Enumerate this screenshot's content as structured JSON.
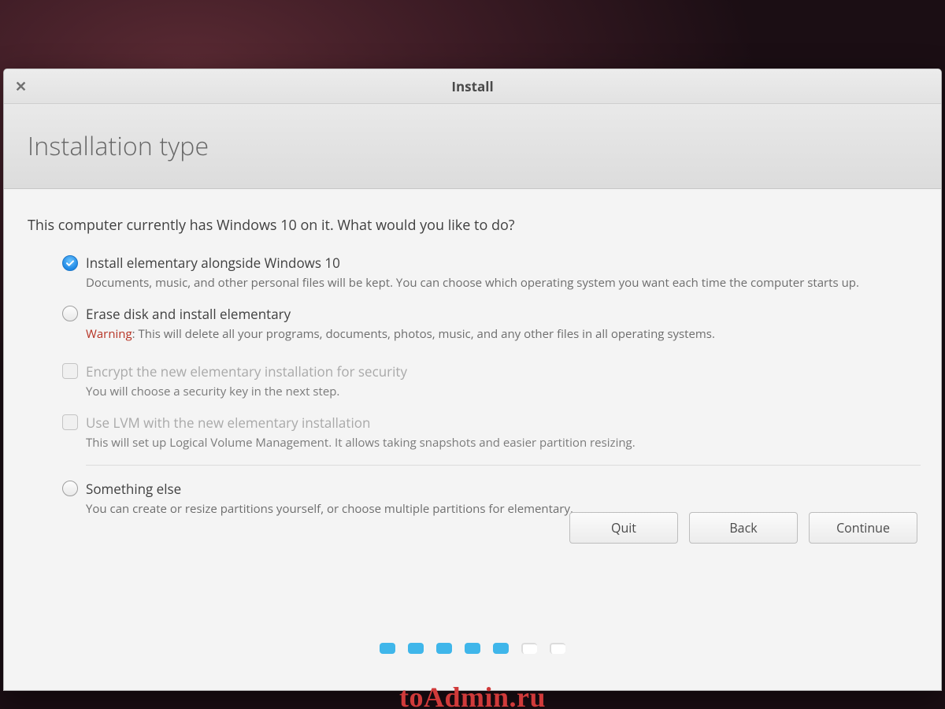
{
  "window": {
    "title": "Install"
  },
  "page": {
    "heading": "Installation type",
    "prompt": "This computer currently has Windows 10 on it. What would you like to do?"
  },
  "options": {
    "alongside": {
      "label": "Install elementary alongside Windows 10",
      "desc": "Documents, music, and other personal files will be kept. You can choose which operating system you want each time the computer starts up.",
      "checked": true
    },
    "erase": {
      "label": "Erase disk and install elementary",
      "warn_prefix": "Warning",
      "desc": ": This will delete all your programs, documents, photos, music, and any other files in all operating systems.",
      "checked": false
    },
    "encrypt": {
      "label": "Encrypt the new elementary installation for security",
      "desc": "You will choose a security key in the next step.",
      "enabled": false
    },
    "lvm": {
      "label": "Use LVM with the new elementary installation",
      "desc": "This will set up Logical Volume Management. It allows taking snapshots and easier partition resizing.",
      "enabled": false
    },
    "something_else": {
      "label": "Something else",
      "desc": "You can create or resize partitions yourself, or choose multiple partitions for elementary.",
      "checked": false
    }
  },
  "buttons": {
    "quit": "Quit",
    "back": "Back",
    "continue": "Continue"
  },
  "progress": {
    "total": 7,
    "filled": 5
  },
  "watermark": "toAdmin.ru"
}
